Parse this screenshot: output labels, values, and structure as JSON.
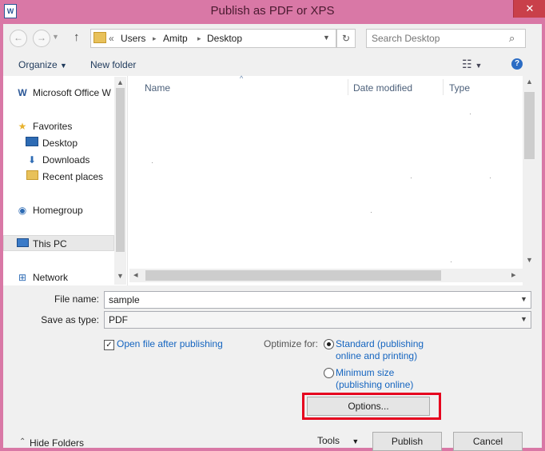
{
  "window": {
    "title": "Publish as PDF or XPS",
    "close_label": "✕",
    "app_icon": "W"
  },
  "navigation": {
    "back_label": "←",
    "forward_label": "→",
    "up_label": "↑",
    "address": {
      "overflow_label": "«",
      "segments": [
        "Users",
        "Amitp",
        "Desktop"
      ],
      "separator": "▸"
    },
    "refresh_label": "↻",
    "search_placeholder": "Search Desktop"
  },
  "toolbar": {
    "organize_label": "Organize",
    "new_folder_label": "New folder",
    "view_label": "☷",
    "help_label": "?"
  },
  "sidebar": {
    "items": [
      {
        "label": "Microsoft Office W",
        "icon": "word-document-icon"
      },
      {
        "label": "Favorites",
        "icon": "star-icon"
      },
      {
        "label": "Desktop",
        "icon": "desktop-icon"
      },
      {
        "label": "Downloads",
        "icon": "downloads-icon"
      },
      {
        "label": "Recent places",
        "icon": "recent-places-icon"
      },
      {
        "label": "Homegroup",
        "icon": "homegroup-icon"
      },
      {
        "label": "This PC",
        "icon": "computer-icon"
      },
      {
        "label": "Network",
        "icon": "network-icon"
      }
    ]
  },
  "file_list": {
    "columns": [
      "Name",
      "Date modified",
      "Type"
    ],
    "sort_indicator": "^"
  },
  "form": {
    "file_name_label": "File name:",
    "file_name_value": "sample",
    "save_type_label": "Save as type:",
    "save_type_value": "PDF",
    "open_after_label": "Open file after publishing",
    "open_after_checked": true,
    "optimize_label": "Optimize for:",
    "standard_line1": "Standard (publishing",
    "standard_line2": "online and printing)",
    "minimum_line1": "Minimum size",
    "minimum_line2": "(publishing online)",
    "selected_option": "standard",
    "options_button": "Options..."
  },
  "footer": {
    "hide_folders_label": "Hide Folders",
    "tools_label": "Tools",
    "publish_button": "Publish",
    "cancel_button": "Cancel"
  },
  "colors": {
    "title_bar": "#d978a6",
    "close_button": "#c9404a",
    "link": "#1565c0",
    "highlight_frame": "#e6001e"
  }
}
